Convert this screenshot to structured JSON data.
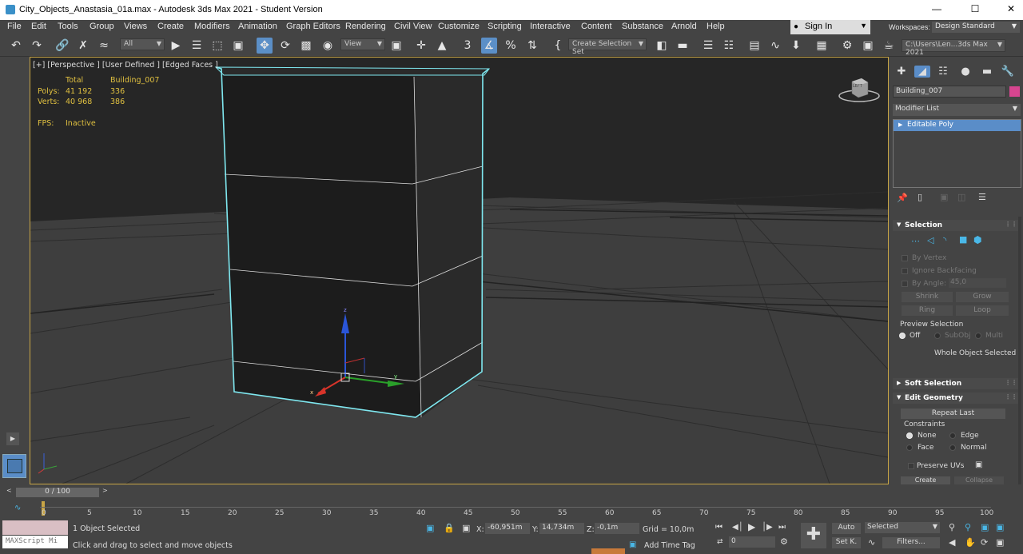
{
  "window": {
    "title": "City_Objects_Anastasia_01a.max - Autodesk 3ds Max 2021 - Student Version",
    "minimize": "—",
    "maximize": "☐",
    "close": "✕"
  },
  "menu": [
    "File",
    "Edit",
    "Tools",
    "Group",
    "Views",
    "Create",
    "Modifiers",
    "Animation",
    "Graph Editors",
    "Rendering",
    "Civil View",
    "Customize",
    "Scripting",
    "Interactive",
    "Content",
    "Substance",
    "Arnold",
    "Help"
  ],
  "signin": "Sign In",
  "workspaces": {
    "label": "Workspaces:",
    "value": "Design Standard"
  },
  "toolbar": {
    "filter": "All",
    "ref_coord": "View",
    "selection_set": "Create Selection Set",
    "project_path": "C:\\Users\\Len...3ds Max 2021"
  },
  "viewport": {
    "label": "[+] [Perspective ] [User Defined ] [Edged Faces ]",
    "stats": {
      "col_total": "Total",
      "col_object": "Building_007",
      "polys_label": "Polys:",
      "polys_total": "41 192",
      "polys_object": "336",
      "verts_label": "Verts:",
      "verts_total": "40 968",
      "verts_object": "386",
      "fps_label": "FPS:",
      "fps_value": "Inactive"
    },
    "viewcube_label": "LEFT",
    "gizmo_axes": {
      "x": "x",
      "y": "y",
      "z": "z"
    }
  },
  "command_panel": {
    "object_name": "Building_007",
    "object_color": "#d6458f",
    "modifier_list": "Modifier List",
    "stack_item": "Editable Poly",
    "selection": {
      "title": "Selection",
      "by_vertex": "By Vertex",
      "ignore_backfacing": "Ignore Backfacing",
      "by_angle": "By Angle:",
      "angle_value": "45,0",
      "shrink": "Shrink",
      "grow": "Grow",
      "ring": "Ring",
      "loop": "Loop",
      "preview_selection": "Preview Selection",
      "preview_off": "Off",
      "preview_subobj": "SubObj",
      "preview_multi": "Multi",
      "status": "Whole Object Selected"
    },
    "soft_selection": {
      "title": "Soft Selection"
    },
    "edit_geometry": {
      "title": "Edit Geometry",
      "repeat_last": "Repeat Last",
      "constraints": "Constraints",
      "none": "None",
      "edge": "Edge",
      "face": "Face",
      "normal": "Normal",
      "preserve_uvs": "Preserve UVs",
      "create": "Create",
      "collapse": "Collapse"
    }
  },
  "timeline": {
    "frame": "0 / 100",
    "ticks": [
      "0",
      "5",
      "10",
      "15",
      "20",
      "25",
      "30",
      "35",
      "40",
      "45",
      "50",
      "55",
      "60",
      "65",
      "70",
      "75",
      "80",
      "85",
      "90",
      "95",
      "100"
    ]
  },
  "status": {
    "maxscript": "MAXScript Mi",
    "selected": "1 Object Selected",
    "prompt": "Click and drag to select and move objects",
    "x_label": "X:",
    "x_value": "-60,951m",
    "y_label": "Y:",
    "y_value": "14,734m",
    "z_label": "Z:",
    "z_value": "-0,1m",
    "grid": "Grid = 10,0m",
    "add_time_tag": "Add Time Tag",
    "auto": "Auto",
    "set_key": "Set K.",
    "key_mode": "Selected",
    "frame_field": "0",
    "filters": "Filters..."
  }
}
